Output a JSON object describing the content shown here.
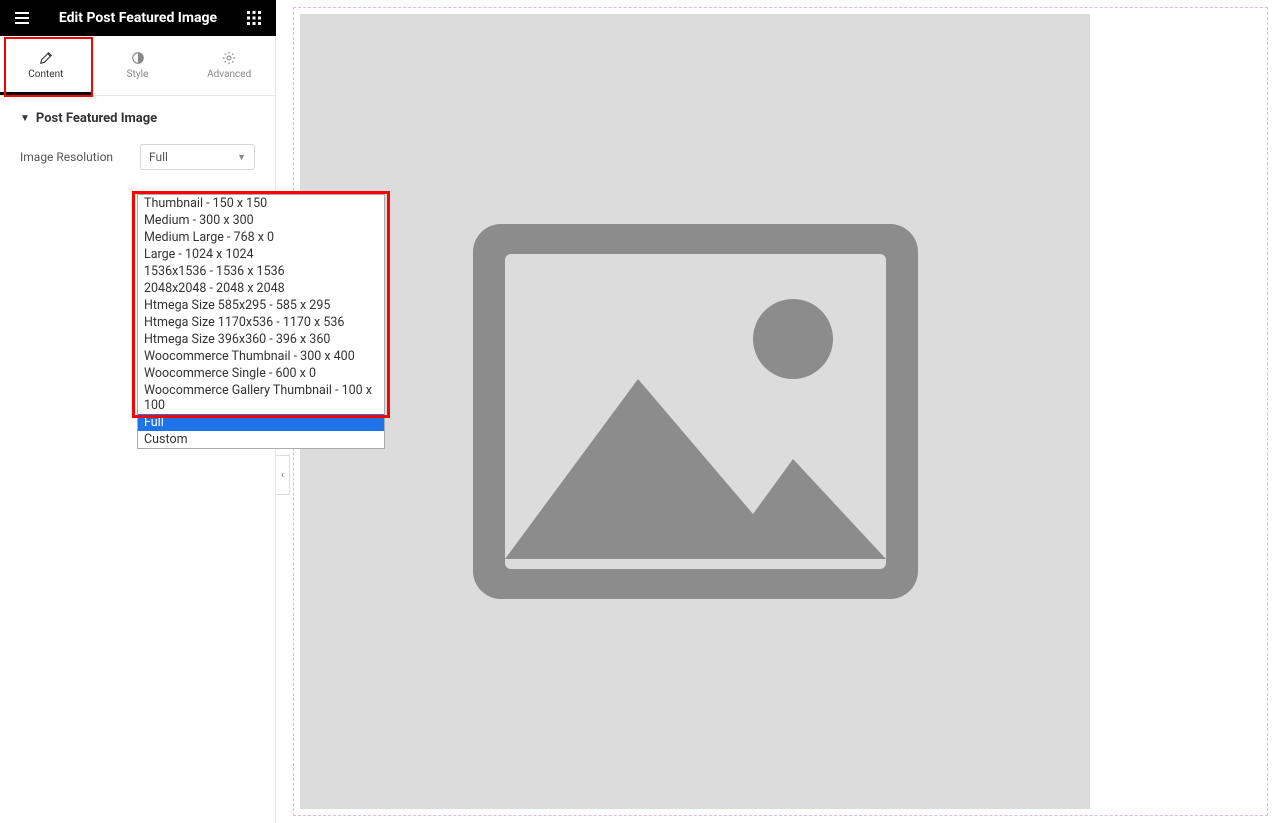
{
  "header": {
    "title": "Edit Post Featured Image"
  },
  "tabs": {
    "content": "Content",
    "style": "Style",
    "advanced": "Advanced"
  },
  "section": {
    "title": "Post Featured Image"
  },
  "controls": {
    "image_resolution_label": "Image Resolution",
    "image_resolution_value": "Full"
  },
  "dropdown": {
    "options": [
      "Thumbnail - 150 x 150",
      "Medium - 300 x 300",
      "Medium Large - 768 x 0",
      "Large - 1024 x 1024",
      "1536x1536 - 1536 x 1536",
      "2048x2048 - 2048 x 2048",
      "Htmega Size 585x295 - 585 x 295",
      "Htmega Size 1170x536 - 1170 x 536",
      "Htmega Size 396x360 - 396 x 360",
      "Woocommerce Thumbnail - 300 x 400",
      "Woocommerce Single - 600 x 0",
      "Woocommerce Gallery Thumbnail - 100 x 100",
      "Full",
      "Custom"
    ],
    "selected_index": 12
  }
}
